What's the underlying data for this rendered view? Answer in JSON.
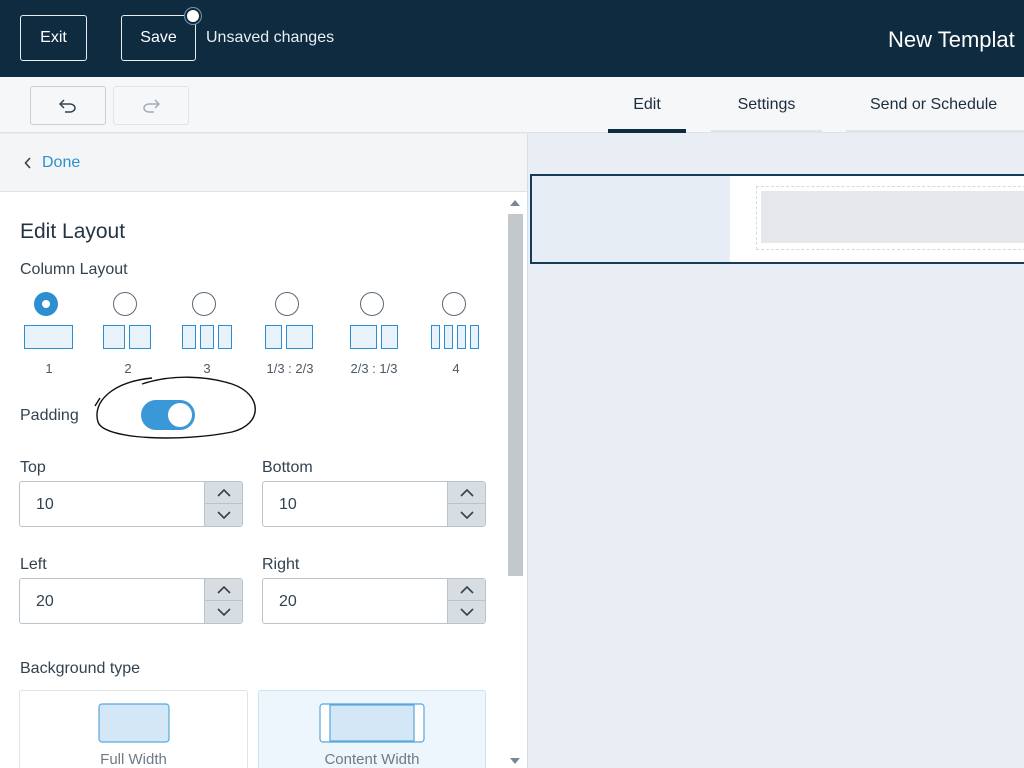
{
  "topbar": {
    "exit_label": "Exit",
    "save_label": "Save",
    "unsaved_text": "Unsaved changes",
    "template_title": "New Templat"
  },
  "tabs": [
    {
      "label": "Edit",
      "active": true
    },
    {
      "label": "Settings",
      "active": false
    },
    {
      "label": "Send or Schedule",
      "active": false
    }
  ],
  "panel": {
    "done_label": "Done",
    "section_title": "Edit Layout",
    "column_layout_label": "Column Layout",
    "column_options": [
      {
        "caption": "1",
        "selected": true
      },
      {
        "caption": "2",
        "selected": false
      },
      {
        "caption": "3",
        "selected": false
      },
      {
        "caption": "1/3 : 2/3",
        "selected": false
      },
      {
        "caption": "2/3 : 1/3",
        "selected": false
      },
      {
        "caption": "4",
        "selected": false
      }
    ],
    "padding_label": "Padding",
    "padding_enabled": true,
    "fields": {
      "top": {
        "label": "Top",
        "value": "10"
      },
      "bottom": {
        "label": "Bottom",
        "value": "10"
      },
      "left": {
        "label": "Left",
        "value": "20"
      },
      "right": {
        "label": "Right",
        "value": "20"
      }
    },
    "background_type_label": "Background type",
    "background_options": [
      {
        "caption": "Full Width",
        "selected": false
      },
      {
        "caption": "Content Width",
        "selected": true
      }
    ]
  },
  "icons": {
    "undo": "undo-icon",
    "redo": "redo-icon",
    "back": "chevron-left-icon",
    "step_up": "chevron-up-icon",
    "step_down": "chevron-down-icon"
  },
  "colors": {
    "topbar_bg": "#0f2b40",
    "accent": "#2e8fd0",
    "toggle_on": "#3a97d8"
  }
}
